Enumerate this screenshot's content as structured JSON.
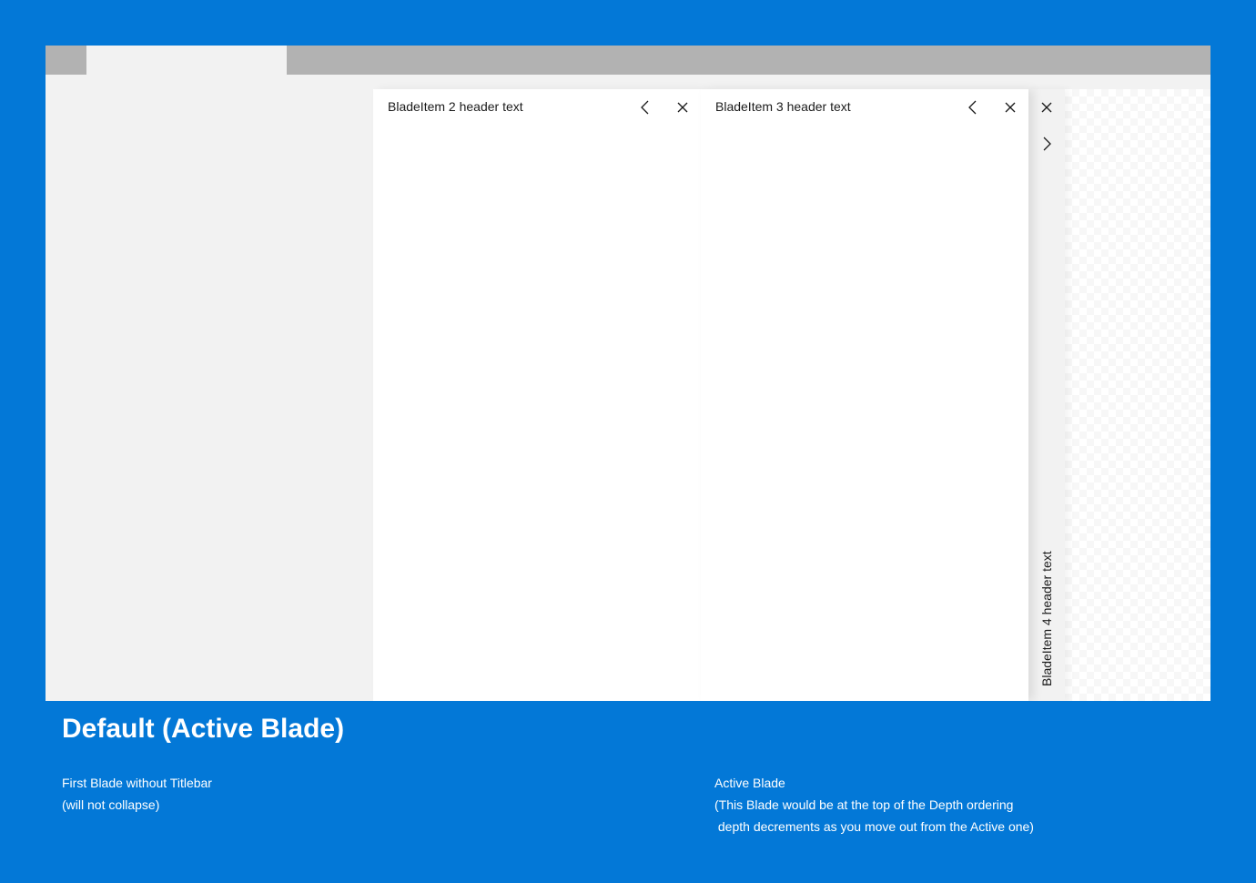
{
  "window": {
    "tabs": [
      {
        "label": ""
      }
    ]
  },
  "blades": [
    {
      "id": "blade-1",
      "header": "",
      "note": "First Blade without Titlebar"
    },
    {
      "id": "blade-2",
      "header": "BladeItem 2 header text",
      "buttons": [
        "chevron-left-icon",
        "close-icon"
      ]
    },
    {
      "id": "blade-3",
      "header": "BladeItem 3 header text",
      "buttons": [
        "chevron-left-icon",
        "close-icon"
      ]
    },
    {
      "id": "blade-4",
      "header": "BladeItem 4 header text",
      "state": "collapsed",
      "buttons": [
        "close-icon",
        "chevron-right-icon"
      ]
    }
  ],
  "caption": {
    "title": "Default (Active Blade)",
    "left_note": [
      "First Blade without Titlebar",
      "(will not collapse)"
    ],
    "right_note": [
      "Active Blade",
      "(This Blade would be at the top of the Depth ordering",
      " depth decrements as you move out from the Active one)"
    ]
  },
  "colors": {
    "background": "#0378d7",
    "tab_bar": "#b2b2b2",
    "chrome": "#f2f2f2",
    "blade": "#ffffff",
    "text": "#1b1b1b"
  }
}
